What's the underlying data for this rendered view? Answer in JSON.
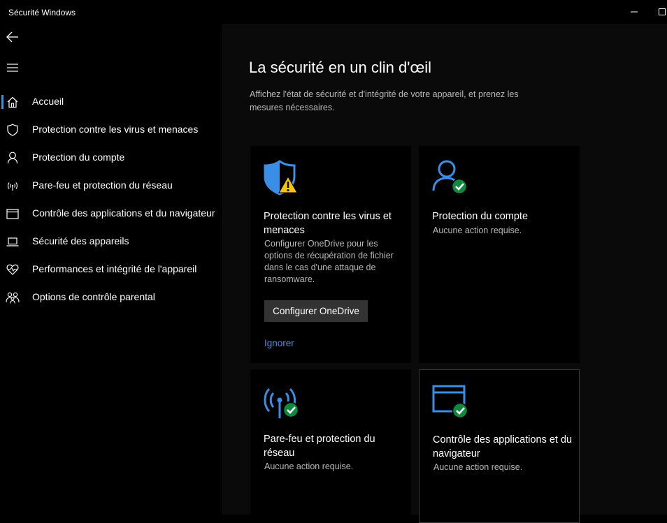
{
  "window": {
    "title": "Sécurité Windows"
  },
  "sidebar": {
    "items": [
      {
        "label": "Accueil",
        "icon": "home-icon",
        "selected": true
      },
      {
        "label": "Protection contre les virus et menaces",
        "icon": "shield-icon"
      },
      {
        "label": "Protection du compte",
        "icon": "person-icon"
      },
      {
        "label": "Pare-feu et protection du réseau",
        "icon": "wifi-antenna-icon"
      },
      {
        "label": "Contrôle des applications et du navigateur",
        "icon": "browser-window-icon"
      },
      {
        "label": "Sécurité des appareils",
        "icon": "laptop-icon"
      },
      {
        "label": "Performances et intégrité de l'appareil",
        "icon": "heart-pulse-icon"
      },
      {
        "label": "Options de contrôle parental",
        "icon": "family-icon"
      }
    ]
  },
  "main": {
    "heading": "La sécurité en un clin d'œil",
    "description": "Affichez l'état de sécurité et d'intégrité de votre appareil, et prenez les mesures nécessaires.",
    "cards": [
      {
        "title": "Protection contre les virus et menaces",
        "subtitle": "Configurer OneDrive pour les options de récupération de fichier dans le cas d'une attaque de ransomware.",
        "button_label": "Configurer OneDrive",
        "link_label": "Ignorer",
        "status": "warning"
      },
      {
        "title": "Protection du compte",
        "subtitle": "Aucune action requise.",
        "status": "ok"
      },
      {
        "title": "Pare-feu et protection du réseau",
        "subtitle": "Aucune action requise.",
        "status": "ok"
      },
      {
        "title": "Contrôle des applications et du navigateur",
        "subtitle": "Aucune action requise.",
        "status": "ok"
      }
    ]
  },
  "colors": {
    "accent": "#3a8ee6",
    "ok": "#10893e",
    "warning": "#f7c600",
    "link": "#3c8ee8"
  }
}
